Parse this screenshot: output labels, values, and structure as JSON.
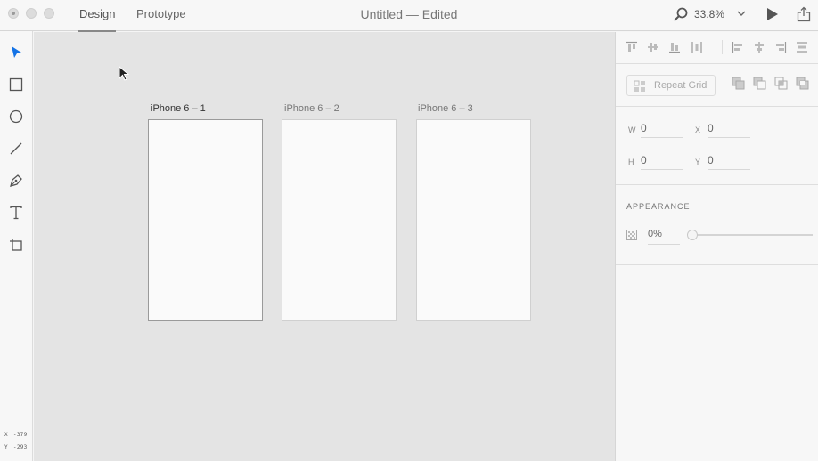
{
  "window": {
    "title": "Untitled — Edited",
    "tabs": [
      {
        "label": "Design",
        "active": true
      },
      {
        "label": "Prototype",
        "active": false
      }
    ],
    "zoom": "33.8%"
  },
  "toolbar": {
    "tools": [
      "select-tool",
      "rectangle-tool",
      "ellipse-tool",
      "line-tool",
      "pen-tool",
      "text-tool",
      "artboard-tool"
    ],
    "coords": {
      "x_label": "X",
      "x_value": "-379",
      "y_label": "Y",
      "y_value": "-293"
    }
  },
  "canvas": {
    "artboards": [
      {
        "label": "iPhone 6 – 1",
        "selected": true
      },
      {
        "label": "iPhone 6 – 2",
        "selected": false
      },
      {
        "label": "iPhone 6 – 3",
        "selected": false
      }
    ]
  },
  "inspector": {
    "repeat_grid_label": "Repeat Grid",
    "fields": {
      "w_label": "W",
      "w_value": "0",
      "x_label": "X",
      "x_value": "0",
      "h_label": "H",
      "h_value": "0",
      "y_label": "Y",
      "y_value": "0"
    },
    "appearance_heading": "APPEARANCE",
    "opacity_value": "0%",
    "opacity_fraction": 0
  },
  "colors": {
    "accent": "#1473e6",
    "canvas": "#e4e4e4",
    "artboard": "#fafafa"
  }
}
